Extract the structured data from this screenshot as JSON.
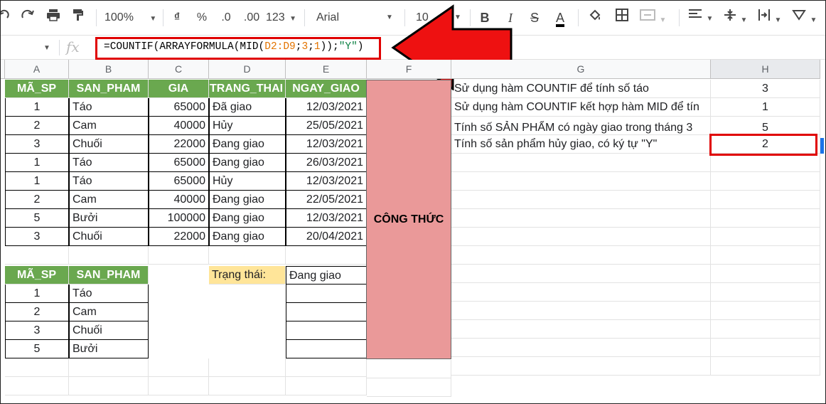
{
  "toolbar": {
    "zoom": "100%",
    "currency": "₫",
    "percent": "%",
    "dec_decrease": ".0",
    "dec_increase": ".00",
    "number_format": "123",
    "font": "Arial",
    "font_size": "10"
  },
  "formula_bar": {
    "fx_label": "fx",
    "formula_prefix": "=COUNTIF(ARRAYFORMULA(MID(",
    "formula_range": "D2:D9",
    "formula_sep1": ";",
    "formula_n1": "3",
    "formula_sep2": ";",
    "formula_n2": "1",
    "formula_mid": "));",
    "formula_str": "\"Y\"",
    "formula_suffix": ")"
  },
  "columns": [
    "A",
    "B",
    "C",
    "D",
    "E",
    "F",
    "G",
    "H"
  ],
  "table1": {
    "headers": [
      "MÃ_SP",
      "SAN_PHAM",
      "GIA",
      "TRANG_THAI",
      "NGAY_GIAO"
    ],
    "rows": [
      [
        "1",
        "Táo",
        "65000",
        "Đã giao",
        "12/03/2021"
      ],
      [
        "2",
        "Cam",
        "40000",
        "Hủy",
        "25/05/2021"
      ],
      [
        "3",
        "Chuối",
        "22000",
        "Đang giao",
        "12/03/2021"
      ],
      [
        "1",
        "Táo",
        "65000",
        "Đang giao",
        "26/03/2021"
      ],
      [
        "1",
        "Táo",
        "65000",
        "Hủy",
        "12/03/2021"
      ],
      [
        "2",
        "Cam",
        "40000",
        "Đang giao",
        "22/05/2021"
      ],
      [
        "5",
        "Bưởi",
        "100000",
        "Đang giao",
        "12/03/2021"
      ],
      [
        "3",
        "Chuối",
        "22000",
        "Đang giao",
        "20/04/2021"
      ]
    ]
  },
  "table2": {
    "headers": [
      "MÃ_SP",
      "SAN_PHAM"
    ],
    "rows": [
      [
        "1",
        "Táo"
      ],
      [
        "2",
        "Cam"
      ],
      [
        "3",
        "Chuối"
      ],
      [
        "5",
        "Bưởi"
      ]
    ]
  },
  "status": {
    "label": "Trạng thái:",
    "value": "Đang giao"
  },
  "formula_column_label": "CÔNG THỨC",
  "results": [
    {
      "desc": "Sử dụng hàm COUNTIF để tính số táo",
      "value": "3"
    },
    {
      "desc": "Sử dụng hàm COUNTIF kết hợp hàm MID để tín",
      "value": "1"
    },
    {
      "desc": "Tính số SẢN PHẨM có ngày giao trong tháng 3",
      "value": "5"
    },
    {
      "desc": "Tính số sản phẩm hủy giao, có ký tự \"Y\"",
      "value": "2"
    }
  ],
  "colors": {
    "header_green": "#6aa84f",
    "formula_pink": "#ea9999",
    "highlight_red": "#e00000",
    "status_yellow": "#ffe599"
  }
}
